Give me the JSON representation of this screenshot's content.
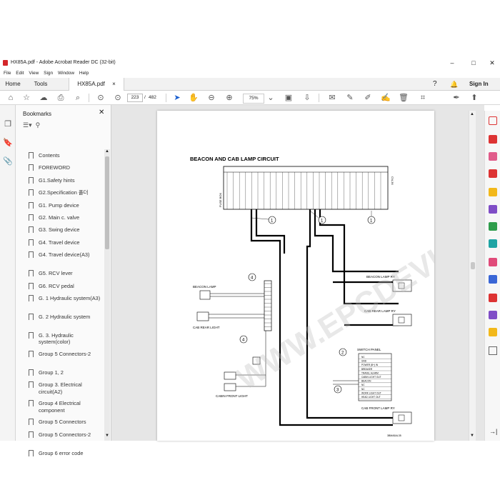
{
  "window": {
    "title": "HX85A.pdf - Adobe Acrobat Reader DC (32-bit)",
    "minimize": "–",
    "maximize": "□",
    "close": "✕"
  },
  "menu": [
    "File",
    "Edit",
    "View",
    "Sign",
    "Window",
    "Help"
  ],
  "tabs": {
    "home": "Home",
    "tools": "Tools",
    "doc": "HX85A.pdf",
    "doc_close": "×",
    "sign_in": "Sign In"
  },
  "toolbar": {
    "page_current": "223",
    "page_sep": "/",
    "page_total": "482",
    "zoom": "75%"
  },
  "bookmarks": {
    "header": "Bookmarks",
    "close": "✕",
    "items": [
      "Contents",
      "FOREWORD",
      "G1.Safety hints",
      "G2.Specification 폴더",
      "G1. Pump device",
      "G2. Main c. valve",
      "G3. Swing device",
      "G4. Travel device",
      "G4. Travel device(A3)",
      "G5. RCV lever",
      "G6. RCV pedal",
      "G. 1  Hydraulic system(A3)",
      "G. 2 Hydraulic system",
      "G. 3. Hydraulic system(color)",
      "Group 5 Connectors-2",
      "Group 1, 2",
      "Group 3. Electrical circuit(A2)",
      "Group 4 Electrical component",
      "Group 5 Connectors",
      "Group 5 Connectors-2",
      "Group 6 error code"
    ]
  },
  "document": {
    "heading": "BEACON AND CAB LAMP CIRCUIT",
    "watermark": "WWW.EPCDEVISE.COM",
    "connector_left": "FUSE BOX",
    "connector_right": "CN-36",
    "beacon_lamp": "BEACON LAMP",
    "cab_rear_light": "CAB REAR LIGHT",
    "cabin_front_light": "CABIN FRONT LIGHT",
    "beacon_lamp_ry": "BEACON LAMP RY",
    "cab_rear_lamp_ry": "CAB REAR LAMP RY",
    "switch_panel": "SWITCH PANEL",
    "cab_front_lamp_ry": "CAB FRONT LAMP RY",
    "switch_rows": [
      "NC",
      "GND",
      "POWER (B+) IN",
      "BREAKER",
      "TRAVEL ALARM",
      "CABIN LIGHT OUT",
      "BEACON",
      "NC",
      "NC",
      "WORK LIGHT OUT",
      "HEAD LIGHT OUT"
    ],
    "callouts": [
      "1",
      "1",
      "1",
      "4",
      "4",
      "2",
      "3"
    ],
    "figure_code": "3BMA5AL35"
  }
}
